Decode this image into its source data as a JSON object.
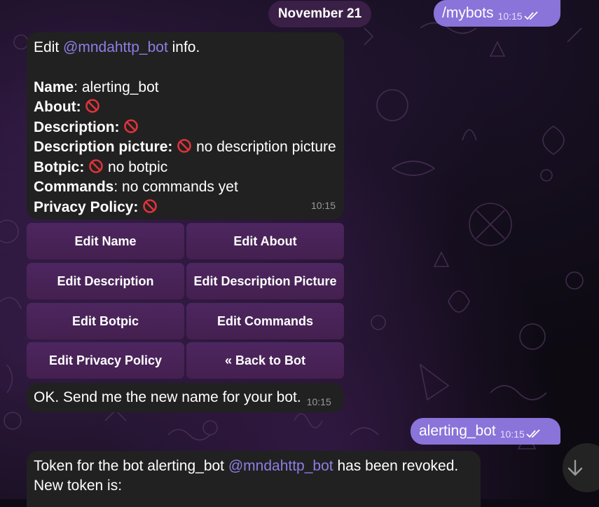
{
  "date_pill": "November 21",
  "messages": {
    "mybots": {
      "text": "/mybots",
      "time": "10:15"
    },
    "info": {
      "edit_prefix": "Edit",
      "edit_mention": "@mndahttp_bot",
      "edit_suffix": "info.",
      "name_label": "Name",
      "name_value": "alerting_bot",
      "about_label": "About:",
      "description_label": "Description:",
      "desc_pic_label": "Description picture:",
      "desc_pic_value": "no description picture",
      "botpic_label": "Botpic:",
      "botpic_value": "no botpic",
      "commands_label": "Commands",
      "commands_value": "no commands yet",
      "privacy_label": "Privacy Policy:",
      "time": "10:15"
    },
    "keyboard": [
      [
        "Edit Name",
        "Edit About"
      ],
      [
        "Edit Description",
        "Edit Description Picture"
      ],
      [
        "Edit Botpic",
        "Edit Commands"
      ],
      [
        "Edit Privacy Policy",
        "« Back to Bot"
      ]
    ],
    "ok": {
      "text": "OK. Send me the new name for your bot.",
      "time": "10:15"
    },
    "alerting": {
      "text": "alerting_bot",
      "time": "10:15"
    },
    "token": {
      "prefix": "Token for the bot alerting_bot",
      "mention": "@mndahttp_bot",
      "suffix": "has been revoked.",
      "line2": "New token is:"
    }
  },
  "icons": {
    "prohibited": "no-entry-sign-icon",
    "read_receipt": "double-check-icon",
    "scroll_down": "arrow-down-icon"
  },
  "colors": {
    "outgoing_bubble": "#8a73d9",
    "incoming_bubble": "#212121",
    "keyboard_button": "#4a2458",
    "mention": "#8d7ee6",
    "date_pill": "#3a1f47"
  }
}
